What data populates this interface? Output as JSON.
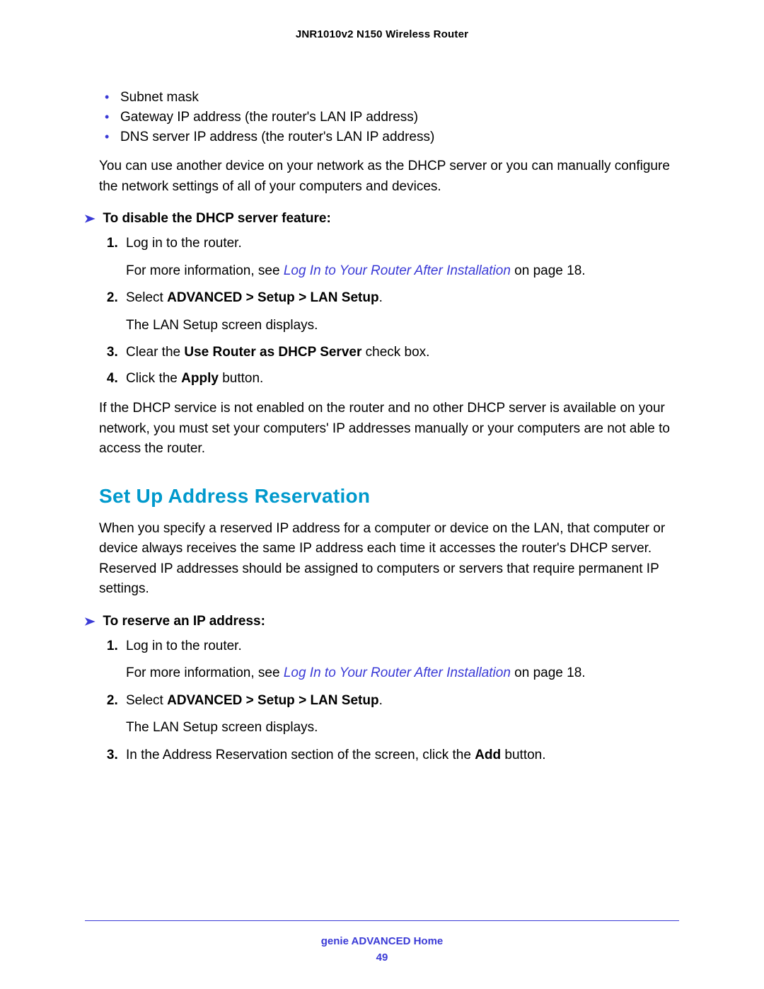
{
  "doc_title": "JNR1010v2 N150 Wireless Router",
  "bullets": {
    "b1": "Subnet mask",
    "b2": "Gateway IP address (the router's LAN IP address)",
    "b3": "DNS server IP address (the router's LAN IP address)"
  },
  "intro_para": "You can use another device on your network as the DHCP server or you can manually configure the network settings of all of your computers and devices.",
  "proc1": {
    "arrow": "➤",
    "heading": "To disable the DHCP server feature:",
    "s1": "Log in to the router.",
    "s1_sub_pre": "For more information, see ",
    "s1_link": "Log In to Your Router After Installation",
    "s1_sub_post": " on page 18.",
    "s2_pre": "Select ",
    "s2_bold": "ADVANCED > Setup > LAN Setup",
    "s2_post": ".",
    "s2_sub": "The LAN Setup screen displays.",
    "s3_pre": "Clear the ",
    "s3_bold": "Use Router as DHCP Server",
    "s3_post": " check box.",
    "s4_pre": "Click the ",
    "s4_bold": "Apply",
    "s4_post": " button."
  },
  "after_proc1": "If the DHCP service is not enabled on the router and no other DHCP server is available on your network, you must set your computers' IP addresses manually or your computers are not able to access the router.",
  "section_heading": "Set Up Address Reservation",
  "section_para": "When you specify a reserved IP address for a computer or device on the LAN, that computer or device always receives the same IP address each time it accesses the router's DHCP server. Reserved IP addresses should be assigned to computers or servers that require permanent IP settings.",
  "proc2": {
    "arrow": "➤",
    "heading": "To reserve an IP address:",
    "s1": "Log in to the router.",
    "s1_sub_pre": "For more information, see ",
    "s1_link": "Log In to Your Router After Installation",
    "s1_sub_post": " on page 18.",
    "s2_pre": "Select ",
    "s2_bold": "ADVANCED > Setup > LAN Setup",
    "s2_post": ".",
    "s2_sub": "The LAN Setup screen displays.",
    "s3_pre": "In the Address Reservation section of the screen, click the ",
    "s3_bold": "Add",
    "s3_post": " button."
  },
  "footer": {
    "title": "genie ADVANCED Home",
    "page": "49"
  }
}
